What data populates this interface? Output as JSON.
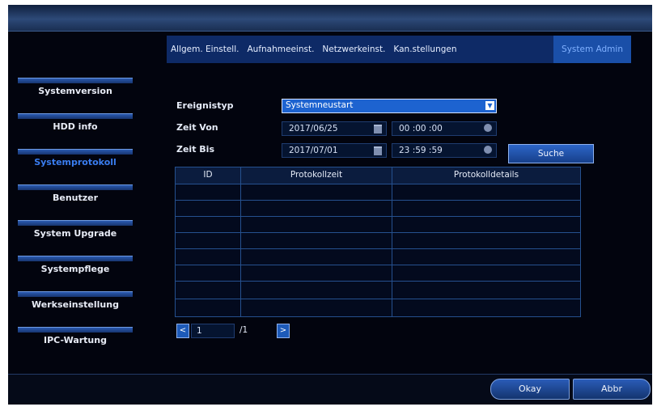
{
  "tabs": [
    {
      "label": "Allgem. Einstell."
    },
    {
      "label": "Aufnahmeeinst."
    },
    {
      "label": "Netzwerkeinst."
    },
    {
      "label": "Kan.stellungen"
    },
    {
      "label": "System Admin",
      "active": true
    }
  ],
  "sidebar": {
    "items": [
      {
        "label": "Systemversion"
      },
      {
        "label": "HDD info"
      },
      {
        "label": "Systemprotokoll",
        "active": true
      },
      {
        "label": "Benutzer"
      },
      {
        "label": "System Upgrade"
      },
      {
        "label": "Systempflege"
      },
      {
        "label": "Werkseinstellung"
      },
      {
        "label": "IPC-Wartung"
      }
    ]
  },
  "form": {
    "event_type_label": "Ereignistyp",
    "event_type_value": "Systemneustart",
    "time_from_label": "Zeit Von",
    "time_from_date": "2017/06/25",
    "time_from_time": "00 :00 :00",
    "time_to_label": "Zeit Bis",
    "time_to_date": "2017/07/01",
    "time_to_time": "23 :59 :59",
    "search_label": "Suche"
  },
  "table": {
    "columns": [
      "ID",
      "Protokollzeit",
      "Protokolldetails"
    ]
  },
  "pager": {
    "current": "1",
    "total": "/1"
  },
  "footer": {
    "ok_label": "Okay",
    "cancel_label": "Abbr"
  },
  "colors": {
    "accent": "#1d63d0",
    "active_text": "#3a7df0"
  }
}
